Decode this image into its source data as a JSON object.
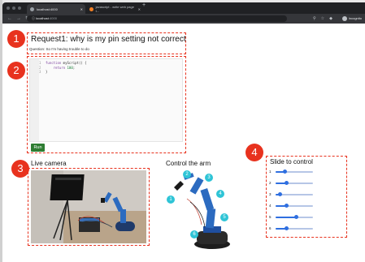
{
  "browser": {
    "tabs": [
      {
        "label": "localhost:4000",
        "active": true
      },
      {
        "label": "javascript - write web page t...",
        "active": false
      }
    ],
    "url_host": "localhost",
    "url_port": ":4000",
    "incognito_label": "Incognito"
  },
  "request": {
    "badge": "1",
    "title": "Request1: why is my pin setting not correct",
    "question": "Question: So I'm having trouble to do"
  },
  "editor": {
    "badge": "2",
    "lines": [
      {
        "num": "1",
        "keyword": "function",
        "rest": " myScript() {"
      },
      {
        "num": "2",
        "keyword": "return",
        "rest": " ",
        "value": "100",
        "tail": ";"
      },
      {
        "num": "3",
        "keyword": "",
        "rest": "}"
      }
    ],
    "run_label": "Run"
  },
  "camera": {
    "badge": "3",
    "title": "Live camera"
  },
  "arm": {
    "title": "Control the arm",
    "joints": [
      "1",
      "2",
      "3",
      "4",
      "5",
      "6"
    ]
  },
  "sliders": {
    "badge": "4",
    "title": "Slide to control",
    "items": [
      {
        "label": "1",
        "value": 0.25
      },
      {
        "label": "2",
        "value": 0.3
      },
      {
        "label": "3",
        "value": 0.12
      },
      {
        "label": "4",
        "value": 0.3
      },
      {
        "label": "5",
        "value": 0.55
      },
      {
        "label": "6",
        "value": 0.3
      }
    ]
  },
  "colors": {
    "annotation": "#e8321e",
    "run_button": "#2e7d32",
    "slider": "#2f6fe0",
    "joint_marker": "#2ec4d6"
  }
}
